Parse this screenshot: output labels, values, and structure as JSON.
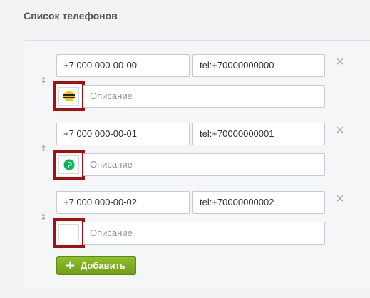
{
  "section": {
    "title": "Список телефонов"
  },
  "phones": [
    {
      "number": "+7 000 000-00-00",
      "link": "tel:+70000000000",
      "description_placeholder": "Описание",
      "operator_icon": "beeline-logo-icon"
    },
    {
      "number": "+7 000 000-00-01",
      "link": "tel:+70000000001",
      "description_placeholder": "Описание",
      "operator_icon": "megafon-logo-icon"
    },
    {
      "number": "+7 000 000-00-02",
      "link": "tel:+70000000002",
      "description_placeholder": "Описание",
      "operator_icon": "empty-icon"
    }
  ],
  "controls": {
    "add_button": "Добавить",
    "remove_icon": "×",
    "drag_icon": "↕",
    "add_icon": "+"
  },
  "colors": {
    "highlight": "#a80d12",
    "add_button": "#7aab1c",
    "beeline_yellow": "#f4c400",
    "megafon_green": "#00b956"
  }
}
